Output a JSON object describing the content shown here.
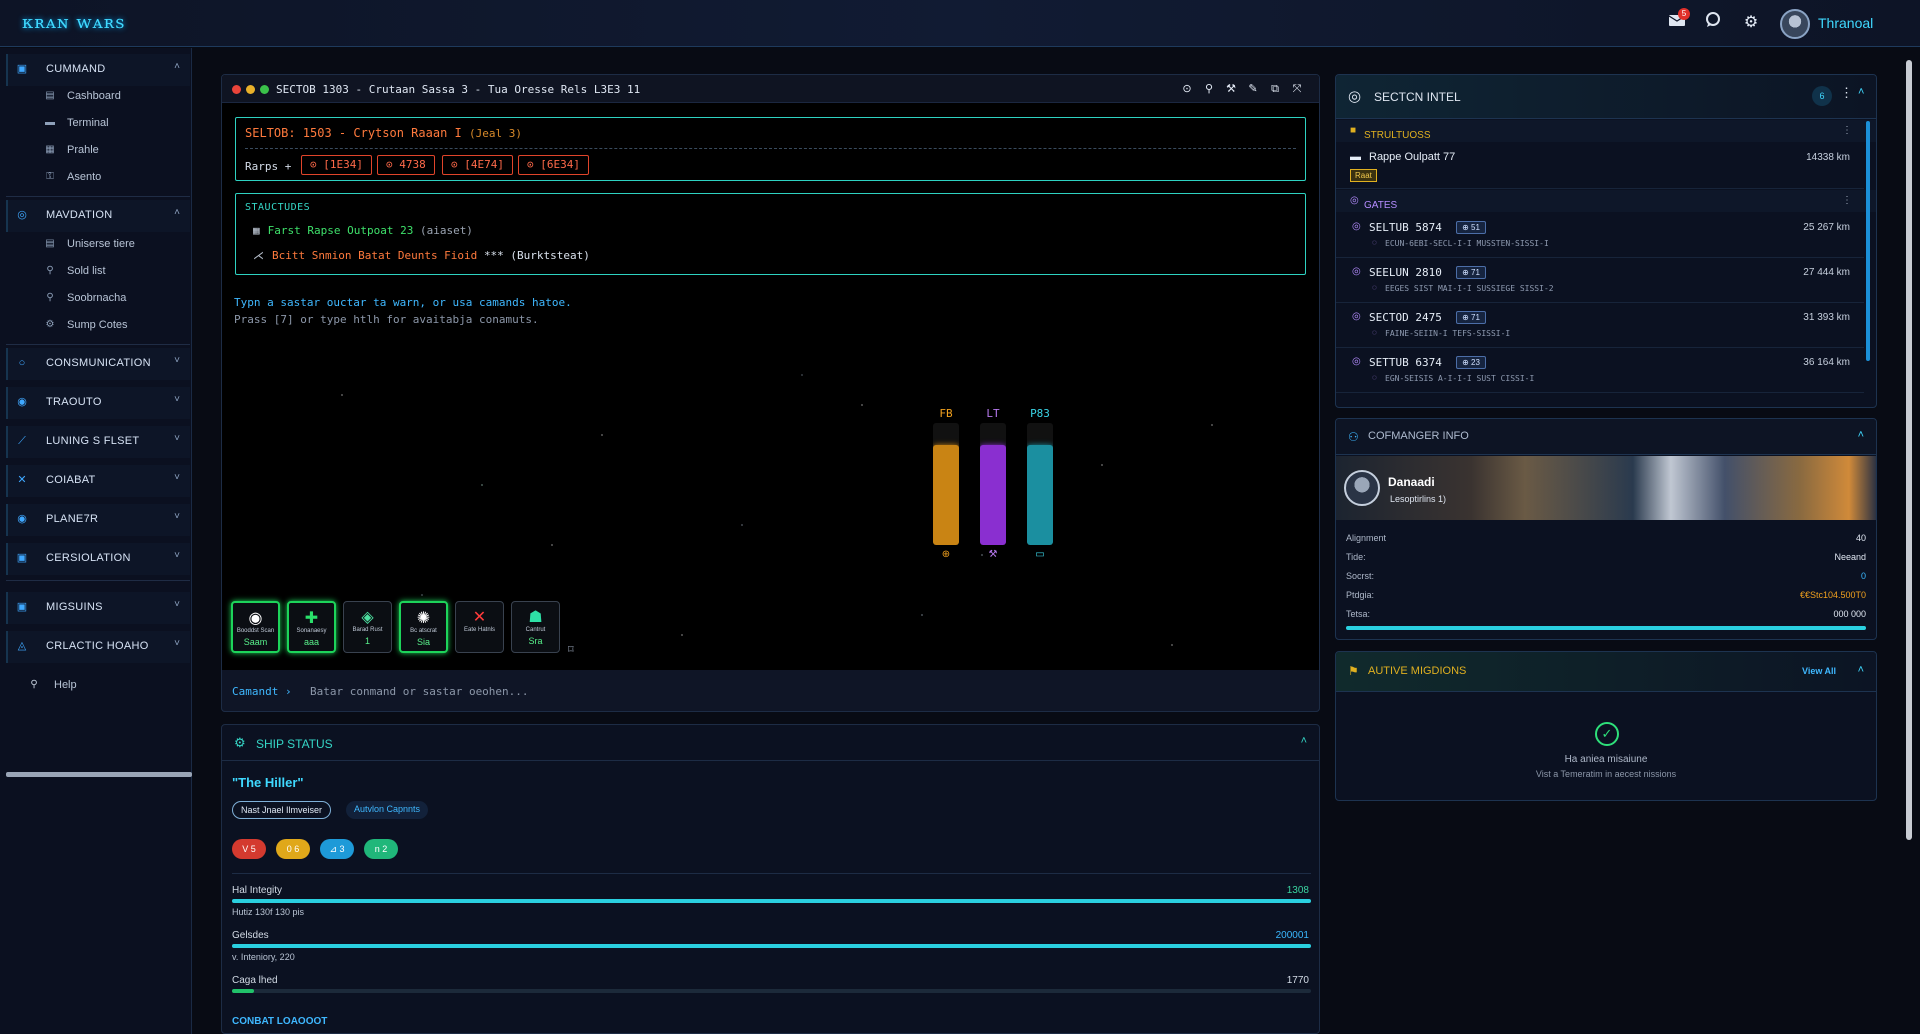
{
  "app": {
    "title": "ᴋʀᴀɴ ᴡᴀʀs"
  },
  "topbar": {
    "user_name": "Thranoal",
    "notification_count": "5",
    "icons": [
      "mail-icon",
      "chat-icon",
      "gear-icon"
    ]
  },
  "sidebar": {
    "groups": [
      {
        "label": "CUMMAND",
        "icon": "command-icon",
        "items": [
          {
            "label": "Cashboard",
            "icon": "dashboard-icon"
          },
          {
            "label": "Terminal",
            "icon": "terminal-icon"
          },
          {
            "label": "Prahle",
            "icon": "profile-icon"
          },
          {
            "label": "Asento",
            "icon": "assets-icon"
          }
        ]
      },
      {
        "label": "MAVDATION",
        "icon": "navigation-icon",
        "items": [
          {
            "label": "Uniserse tiere",
            "icon": "universe-icon"
          },
          {
            "label": "Sold list",
            "icon": "list-icon"
          },
          {
            "label": "Soobrnacha",
            "icon": "pin-icon"
          },
          {
            "label": "Sump Cotes",
            "icon": "gates-icon"
          }
        ]
      },
      {
        "label": "CONSMUNICATION",
        "icon": "comms-icon"
      },
      {
        "label": "TRAOUTO",
        "icon": "trade-icon"
      },
      {
        "label": "LUNING S FLSET",
        "icon": "fleet-icon"
      },
      {
        "label": "COIABAT",
        "icon": "combat-icon"
      },
      {
        "label": "PLANE7R",
        "icon": "planet-icon"
      },
      {
        "label": "CERSIOLATION",
        "icon": "corporation-icon"
      },
      {
        "label": "MIGSUINS",
        "icon": "missions-icon"
      },
      {
        "label": "CRLACTIC HOAHO",
        "icon": "galactic-icon"
      }
    ],
    "help_label": "Help"
  },
  "terminal": {
    "title": "SECTOB 1303 - Crutaan Sassa 3 - Tua Oresse Rels L3E3 11",
    "sector_line": "SELTOB: 1503 - Crytson Raaan I",
    "sector_tag": "(Jeal 3)",
    "warps_label": "Rarps +",
    "warps": [
      "⊙ [1E34]",
      "⊙ 4738",
      "⊙ [4E74]",
      "⊙ [6E34]"
    ],
    "structures_title": "STAUCTUDES",
    "structures": [
      {
        "icon": "▦",
        "text": "Farst Rapse Outpoat 23",
        "tag": "(aiaset)"
      },
      {
        "icon": "⋌",
        "text": "Bcitt Snmion Batat Deunts Fioid",
        "tag": "*** (Burktsteat)"
      }
    ],
    "hint1": "Typn a sastar ouctar ta warn, or usa camands hatoe.",
    "hint2": "Prass [7] or type htlh for avaitabja conamuts.",
    "gauges": [
      {
        "label": "FB",
        "level": 0.82,
        "color": "#c98414",
        "label_color": "#f2a11e",
        "icon": "⊕"
      },
      {
        "label": "LT",
        "level": 0.82,
        "color": "#8a2fd0",
        "label_color": "#b87af0",
        "icon": "⚒"
      },
      {
        "label": "P83",
        "level": 0.82,
        "color": "#1b8fa0",
        "label_color": "#3ad4e6",
        "icon": "▭"
      }
    ],
    "actions": [
      {
        "name": "scan-button",
        "icon": "◉",
        "label": "Booddst Scan",
        "value": "Saam",
        "active": true,
        "color": "#ffffff"
      },
      {
        "name": "repair-button",
        "icon": "✚",
        "label": "Sonanaesy",
        "value": "aaa",
        "active": true,
        "color": "#2ae06a"
      },
      {
        "name": "shield-button",
        "icon": "◈",
        "label": "Barad Rust",
        "value": "1",
        "active": false,
        "color": "#4de0a0"
      },
      {
        "name": "engine-button",
        "icon": "✺",
        "label": "Bc atscrat",
        "value": "Sia",
        "active": true,
        "color": "#ffffff"
      },
      {
        "name": "cancel-action-button",
        "icon": "✕",
        "label": "Eate Hatnls",
        "value": "",
        "active": false,
        "color": "#ff3b3b"
      },
      {
        "name": "combat-button",
        "icon": "☗",
        "label": "Cantrut",
        "value": "Sra",
        "active": false,
        "color": "#2ee0a6"
      }
    ],
    "command_prompt": "Camandt ›",
    "command_placeholder": "Batar conmand or sastar oeohen..."
  },
  "ship": {
    "title": "SHIP STATUS",
    "name": "\"The Hiller\"",
    "pills": [
      "Nast Jnael Ilmveiser",
      "Autvlon Capnnts"
    ],
    "badges": [
      {
        "text": "V 5",
        "color": "#d43a2f"
      },
      {
        "text": "0 6",
        "color": "#e0a81a"
      },
      {
        "text": "⊿ 3",
        "color": "#1e9ad8"
      },
      {
        "text": "n 2",
        "color": "#20b77a"
      }
    ],
    "stats": [
      {
        "label": "Hal Integity",
        "value": "1308",
        "fraction": 1.0,
        "sub": "Hutiz 130f 130 pis",
        "color": "#2ad0e0",
        "value_color": "#3ad4a0"
      },
      {
        "label": "Gelsdes",
        "value": "200001",
        "fraction": 1.0,
        "sub": "v. Inteniory, 220",
        "color": "#2ad0e0",
        "value_color": "#3ab8ff"
      },
      {
        "label": "Caga lhed",
        "value": "1770",
        "fraction": 0.02,
        "sub": "",
        "color": "#21c26a",
        "value_color": "#d3dbe6"
      }
    ],
    "loadout_title": "CONBAT LOAOOOT"
  },
  "intel": {
    "title": "SECTCN INTEL",
    "count": "6",
    "structures_label": "STRULTUOSS",
    "structure": {
      "name": "Rappe Oulpatt 77",
      "tag": "Raat",
      "dist": "14338 km"
    },
    "gates_label": "GATES",
    "gates": [
      {
        "name": "SELTUB 5874",
        "badge": "⊕ 51",
        "sub": "ECUN-6EBI-SECL-I-I MUSSTEN-SISSI-I",
        "dist": "25 267 km"
      },
      {
        "name": "SEELUN 2810",
        "badge": "⊕ 71",
        "sub": "EEGES SIST MAI-I-I SUSSIEGE SISSI-2",
        "dist": "27 444 km"
      },
      {
        "name": "SECTOD 2475",
        "badge": "⊕ 71",
        "sub": "FAINE-SEIIN-I TEFS-SISSI-I",
        "dist": "31 393 km"
      },
      {
        "name": "SETTUB 6374",
        "badge": "⊕ 23",
        "sub": "EGN-SEISIS A-I-I-I SUST CISSI-I",
        "dist": "36 164 km"
      }
    ]
  },
  "commander": {
    "title": "COFMANGER INFO",
    "name": "Danaadi",
    "subtitle": "Lesoptirlins 1)",
    "rows": [
      {
        "key": "Alignment",
        "value": "40",
        "color": "#dfe6f1"
      },
      {
        "key": "Tide:",
        "value": "Neeand",
        "color": "#dfe6f1"
      },
      {
        "key": "Socrst:",
        "value": "0",
        "color": "#3ab8ff"
      },
      {
        "key": "Ptdgia:",
        "value": "€€Stc104.500T0",
        "color": "#f2a11e"
      },
      {
        "key": "Tetsa:",
        "value": "000 000",
        "color": "#dfe6f1"
      }
    ],
    "progress": 1.0
  },
  "missions": {
    "title": "AUTIVE MIGDIONS",
    "view_all": "View All",
    "empty_title": "Ha aniea misaiune",
    "empty_sub": "Vist a Temeratim in aecest nissions"
  }
}
